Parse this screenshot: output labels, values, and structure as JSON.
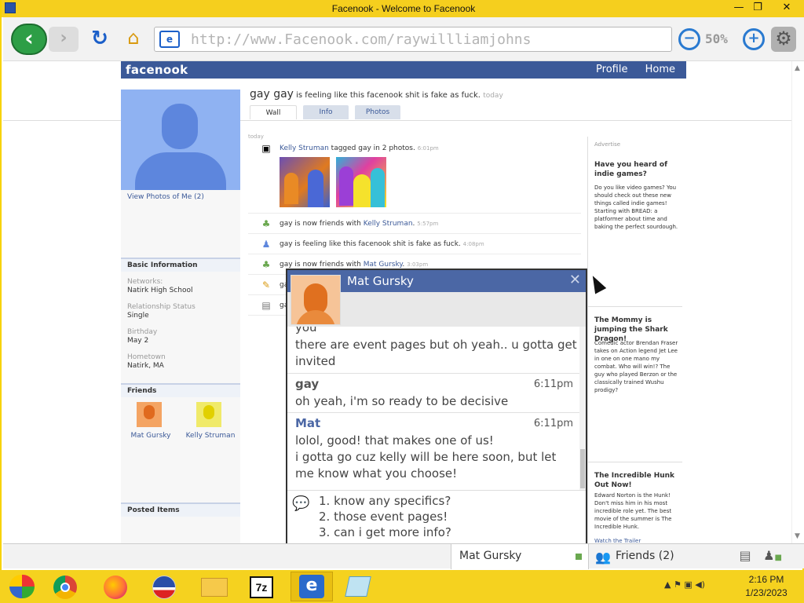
{
  "window": {
    "title": "Facenook - Welcome to Facenook",
    "minimize": "—",
    "maximize": "❐",
    "close": "✕"
  },
  "browser": {
    "back": "‹",
    "forward": "›",
    "refresh": "↻",
    "home": "⌂",
    "page_icon": "e",
    "url": "http://www.Facenook.com/raywillliamjohns",
    "zoom_out": "−",
    "zoom_level": "50%",
    "zoom_in": "+",
    "settings": "⚙"
  },
  "site": {
    "logo": "facenook",
    "nav": [
      "Profile",
      "Home"
    ]
  },
  "profile": {
    "view_photos": "View Photos of Me (2)",
    "basic_info_header": "Basic Information",
    "info": [
      {
        "label": "Networks:",
        "value": "Natirk High School"
      },
      {
        "label": "Relationship Status",
        "value": "Single"
      },
      {
        "label": "Birthday",
        "value": "May 2"
      },
      {
        "label": "Hometown",
        "value": "Natirk, MA"
      }
    ],
    "friends_header": "Friends",
    "friends": [
      "Mat Gursky",
      "Kelly Struman"
    ],
    "posted_items_header": "Posted Items"
  },
  "status": {
    "name": "gay gay",
    "text": " is feeling like this facenook shit is fake as fuck.",
    "when": "today"
  },
  "tabs": [
    "Wall",
    "Info",
    "Photos"
  ],
  "feed": {
    "today_label": "today",
    "items": [
      {
        "icon": "▣",
        "pre": "",
        "link": "Kelly Struman",
        "post": " tagged gay in 2 photos.",
        "time": "6:01pm"
      },
      {
        "icon": "♣",
        "pre": "gay is now friends with ",
        "link": "Kelly Struman",
        "post": ".",
        "time": "5:57pm"
      },
      {
        "icon": "♟",
        "pre": "gay is feeling like this facenook shit is fake as fuck.",
        "link": "",
        "post": "",
        "time": "4:08pm"
      },
      {
        "icon": "♣",
        "pre": "gay is now friends with ",
        "link": "Mat Gursky",
        "post": ".",
        "time": "3:03pm"
      },
      {
        "icon": "✎",
        "pre": "ga",
        "link": "",
        "post": "",
        "time": ""
      },
      {
        "icon": "▤",
        "pre": "ga",
        "link": "",
        "post": "",
        "time": ""
      }
    ]
  },
  "ads": {
    "label": "Advertise",
    "items": [
      {
        "title": "Have you heard of indie games?",
        "body": "Do you like video games? You should check out these new things called indie games! Starting with BREAD: a platformer about time and baking the perfect sourdough."
      },
      {
        "title": "The Mommy is jumping the Shark Dragon!",
        "body": "Comedic actor Brendan Fraser takes on Action legend Jet Lee in one on one mano my combat. Who will win!? The guy who played Berzon or the classically trained Wushu prodigy?"
      },
      {
        "title": "The Incredible Hunk Out Now!",
        "body": "Edward Norton is the Hunk! Don't miss him in his most incredible role yet. The best movie of the summer is The Incredible Hunk.",
        "link": "Watch the Trailer"
      }
    ]
  },
  "chat": {
    "name": "Mat Gursky",
    "close": "✕",
    "messages": [
      {
        "sender": "",
        "time": "",
        "lines": [
          "you",
          "there are event pages but oh yeah.. u gotta get",
          "invited"
        ]
      },
      {
        "sender": "gay",
        "time": "6:11pm",
        "lines": [
          "oh yeah, i'm so ready to be decisive"
        ]
      },
      {
        "sender": "Mat",
        "time": "6:11pm",
        "lines": [
          "lolol, good! that makes one of us!",
          "i gotta go cuz kelly will be here soon, but let",
          "me know what you choose!"
        ]
      }
    ],
    "options": [
      "1. know any specifics?",
      "2. those event pages!",
      "3. can i get more info?"
    ]
  },
  "chatbar": {
    "tab_label": "Mat Gursky",
    "friends_label": "Friends (2)"
  },
  "taskbar": {
    "time": "2:16 PM",
    "date": "1/23/2023",
    "tray": "▲  ⚑  ▣  ◀)"
  },
  "colors": {
    "fb_blue": "#3b5998",
    "taskbar_yellow": "#f5d21f"
  }
}
